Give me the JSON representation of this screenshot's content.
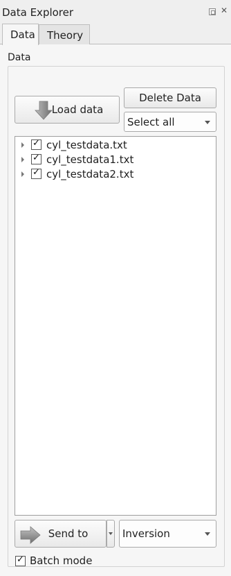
{
  "window": {
    "title": "Data Explorer"
  },
  "tabs": [
    {
      "label": "Data",
      "active": true
    },
    {
      "label": "Theory",
      "active": false
    }
  ],
  "data_group": {
    "title": "Data",
    "load_label": "Load data",
    "delete_label": "Delete Data",
    "select_value": "Select all",
    "files": [
      {
        "name": "cyl_testdata.txt",
        "checked": true
      },
      {
        "name": "cyl_testdata1.txt",
        "checked": true
      },
      {
        "name": "cyl_testdata2.txt",
        "checked": true
      }
    ],
    "send_label": "Send to",
    "perspective_value": "Inversion",
    "batch_label": "Batch mode",
    "batch_checked": true
  },
  "icons": {
    "float": "float-icon",
    "close": "close-icon",
    "load": "arrow-down-icon",
    "send": "arrow-right-icon"
  },
  "colors": {
    "background": "#efefef",
    "panel": "#f6f6f6",
    "list_bg": "#ffffff"
  }
}
